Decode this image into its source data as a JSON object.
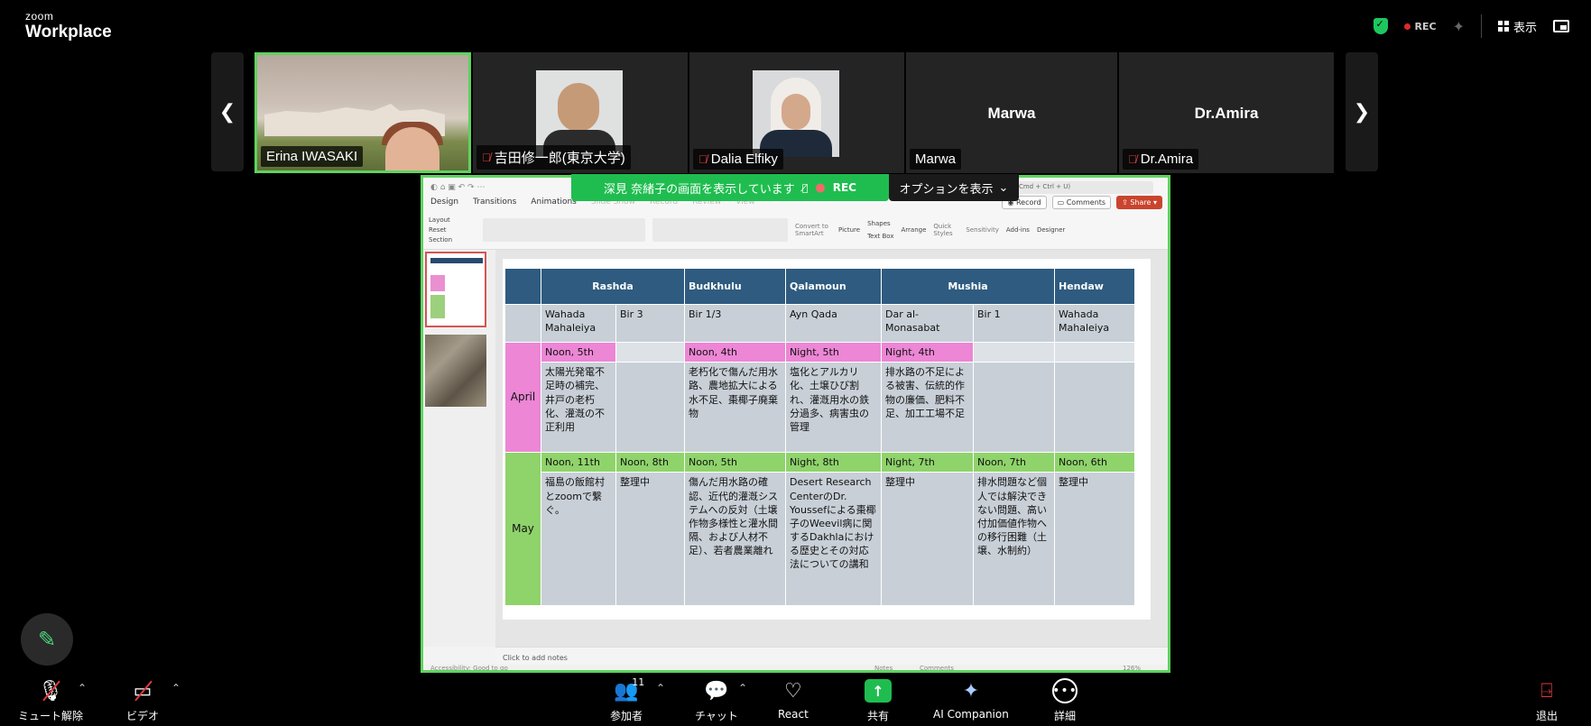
{
  "app": {
    "brand_small": "zoom",
    "brand_large": "Workplace"
  },
  "topbar": {
    "rec": "REC",
    "view_label": "表示"
  },
  "participants": [
    {
      "name": "Erina IWASAKI",
      "muted": false
    },
    {
      "name": "吉田修一郎(東京大学)",
      "muted": true
    },
    {
      "name": "Dalia Elfiky",
      "muted": true
    },
    {
      "name": "Marwa",
      "center": "Marwa",
      "muted": false
    },
    {
      "name": "Dr.Amira",
      "center": "Dr.Amira",
      "muted": true
    }
  ],
  "share": {
    "banner": "深見 奈緒子の画面を表示しています",
    "banner_rec": "REC",
    "options": "オプションを表示"
  },
  "ppt": {
    "tabs": [
      "Design",
      "Transitions",
      "Animations",
      "Slide Show",
      "Record",
      "Review",
      "View"
    ],
    "search": "rch (Cmd + Ctrl + U)",
    "record": "Record",
    "comments": "Comments",
    "share": "Share",
    "layout": "Layout",
    "reset": "Reset",
    "section": "Section",
    "picture": "Picture",
    "shapes": "Shapes",
    "textbox": "Text Box",
    "arrange": "Arrange",
    "quick_styles": "Quick Styles",
    "sensitivity": "Sensitivity",
    "addins": "Add-ins",
    "designer": "Designer",
    "convert": "Convert to SmartArt",
    "notes_placeholder": "Click to add notes",
    "accessibility": "Accessibility: Good to go",
    "notes_btn": "Notes",
    "comments_btn": "Comments",
    "zoom": "126%"
  },
  "table": {
    "headers": [
      "Rashda",
      "Budkhulu",
      "Qalamoun",
      "Mushia",
      "Hendaw"
    ],
    "subheaders": [
      "Wahada Mahaleiya",
      "Bir 3",
      "Bir 1/3",
      "Ayn Qada",
      "Dar al-Monasabat",
      "Bir 1",
      "Wahada Mahaleiya"
    ],
    "april_label": "April",
    "april_times": [
      "Noon, 5th",
      "",
      "Noon, 4th",
      "Night, 5th",
      "Night, 4th",
      "",
      ""
    ],
    "april_notes": [
      "太陽光発電不足時の補完、井戸の老朽化、灌漑の不正利用",
      "",
      "老朽化で傷んだ用水路、農地拡大による水不足、棗椰子廃棄物",
      "塩化とアルカリ化、土壌ひび割れ、灌漑用水の鉄分過多、病害虫の管理",
      "排水路の不足による被害、伝統的作物の廉価、肥料不足、加工工場不足",
      "",
      ""
    ],
    "may_label": "May",
    "may_times": [
      "Noon, 11th",
      "Noon, 8th",
      "Noon, 5th",
      "Night, 8th",
      "Night, 7th",
      "Noon, 7th",
      "Noon, 6th"
    ],
    "may_notes": [
      "福島の飯館村とzoomで繋ぐ。",
      "整理中",
      "傷んだ用水路の確認、近代的灌漑システムへの反対（土壌作物多様性と灌水間隔、および人材不足）、若者農業離れ",
      "Desert Research CenterのDr. Youssefによる棗椰子のWeevil病に関するDakhlaにおける歴史とその対応法についての講和",
      "整理中",
      "排水問題など個人では解決できない問題、高い付加価値作物への移行困難（土壌、水制約）",
      "整理中"
    ]
  },
  "toolbar": {
    "mute": "ミュート解除",
    "video": "ビデオ",
    "participants": "参加者",
    "participants_count": "11",
    "chat": "チャット",
    "react": "React",
    "share": "共有",
    "ai": "AI Companion",
    "more": "詳細",
    "leave": "退出"
  },
  "colors": {
    "accent_green": "#1fbd4f",
    "header_blue": "#2e5b7f",
    "april_pink": "#ec86d5",
    "may_green": "#8fd36b"
  }
}
